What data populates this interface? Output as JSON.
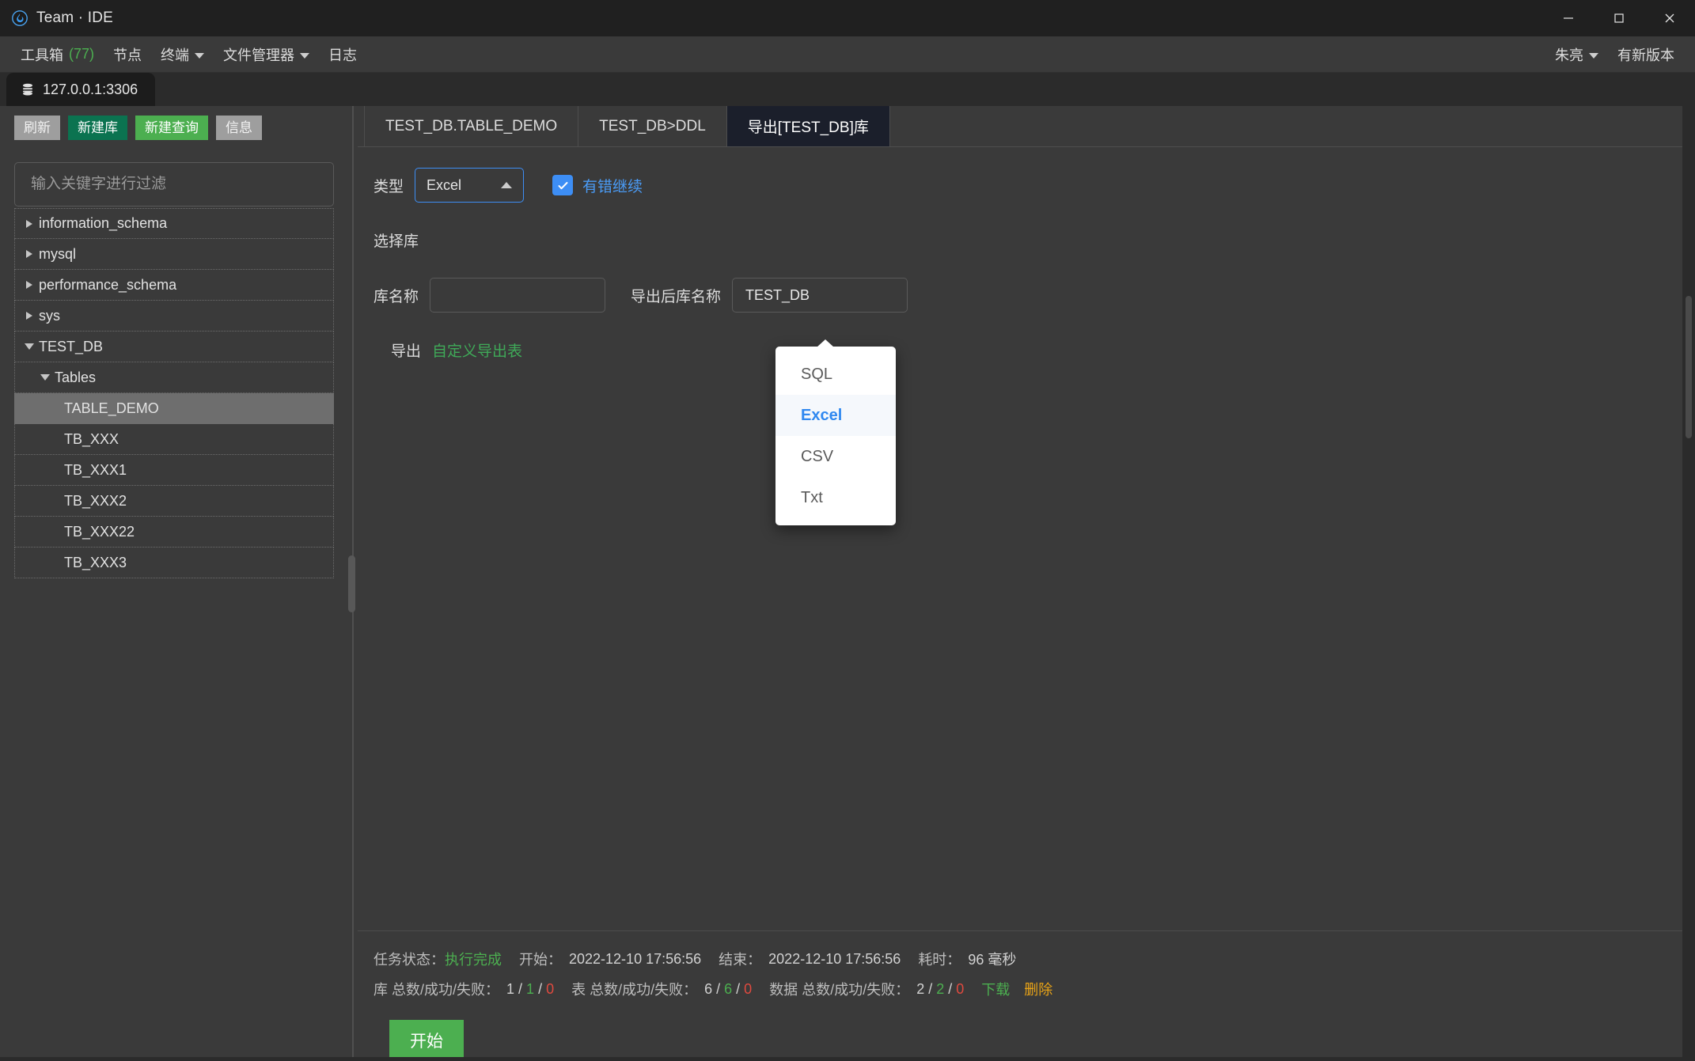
{
  "window": {
    "title": "Team · IDE",
    "logo_icon": "flame-icon",
    "minimize_icon": "minimize-icon",
    "maximize_icon": "maximize-icon",
    "close_icon": "close-icon"
  },
  "menubar": {
    "items": [
      {
        "label": "工具箱",
        "count": "(77)",
        "has_caret": false
      },
      {
        "label": "节点",
        "count": "",
        "has_caret": false
      },
      {
        "label": "终端",
        "count": "",
        "has_caret": true
      },
      {
        "label": "文件管理器",
        "count": "",
        "has_caret": true
      },
      {
        "label": "日志",
        "count": "",
        "has_caret": false
      }
    ],
    "user": "朱亮",
    "update": "有新版本"
  },
  "connection_tab": {
    "label": "127.0.0.1:3306",
    "icon": "database-icon"
  },
  "sidebar": {
    "buttons": [
      {
        "label": "刷新",
        "style": "gray"
      },
      {
        "label": "新建库",
        "style": "dkgreen"
      },
      {
        "label": "新建查询",
        "style": "green"
      },
      {
        "label": "信息",
        "style": "gray"
      }
    ],
    "filter_placeholder": "输入关键字进行过滤",
    "filter_value": "",
    "tree": [
      {
        "label": "information_schema",
        "level": 1,
        "state": "collapsed",
        "selected": false
      },
      {
        "label": "mysql",
        "level": 1,
        "state": "collapsed",
        "selected": false
      },
      {
        "label": "performance_schema",
        "level": 1,
        "state": "collapsed",
        "selected": false
      },
      {
        "label": "sys",
        "level": 1,
        "state": "collapsed",
        "selected": false
      },
      {
        "label": "TEST_DB",
        "level": 1,
        "state": "expanded",
        "selected": false
      },
      {
        "label": "Tables",
        "level": 2,
        "state": "expanded",
        "selected": false
      },
      {
        "label": "TABLE_DEMO",
        "level": 3,
        "state": "leaf",
        "selected": true
      },
      {
        "label": "TB_XXX",
        "level": 3,
        "state": "leaf",
        "selected": false
      },
      {
        "label": "TB_XXX1",
        "level": 3,
        "state": "leaf",
        "selected": false
      },
      {
        "label": "TB_XXX2",
        "level": 3,
        "state": "leaf",
        "selected": false
      },
      {
        "label": "TB_XXX22",
        "level": 3,
        "state": "leaf",
        "selected": false
      },
      {
        "label": "TB_XXX3",
        "level": 3,
        "state": "leaf",
        "selected": false
      }
    ]
  },
  "editor_tabs": [
    {
      "label": "TEST_DB.TABLE_DEMO",
      "active": false
    },
    {
      "label": "TEST_DB>DDL",
      "active": false
    },
    {
      "label": "导出[TEST_DB]库",
      "active": true
    }
  ],
  "export_form": {
    "type_label": "类型",
    "type_value": "Excel",
    "type_chevron_icon": "chevron-up-icon",
    "type_options": [
      {
        "label": "SQL",
        "selected": false
      },
      {
        "label": "Excel",
        "selected": true
      },
      {
        "label": "CSV",
        "selected": false
      },
      {
        "label": "Txt",
        "selected": false
      }
    ],
    "continue_on_error_label": "有错继续",
    "continue_on_error_checked": true,
    "check_icon": "check-icon",
    "select_db_label": "选择库",
    "db_name_label": "库名称",
    "db_name_value": "",
    "export_db_name_label": "导出后库名称",
    "export_db_name_value": "TEST_DB",
    "export_table_label": "导出",
    "custom_export_link": "自定义导出表"
  },
  "status": {
    "task_state_label": "任务状态：",
    "task_state_value": "执行完成",
    "start_label": "开始：",
    "start_value": "2022-12-10 17:56:56",
    "end_label": "结束：",
    "end_value": "2022-12-10 17:56:56",
    "elapsed_label": "耗时：",
    "elapsed_value": "96 毫秒",
    "db_counts_label": "库 总数/成功/失败：",
    "db_total": "1",
    "db_ok": "1",
    "db_fail": "0",
    "table_counts_label": "表 总数/成功/失败：",
    "table_total": "6",
    "table_ok": "6",
    "table_fail": "0",
    "data_counts_label": "数据 总数/成功/失败：",
    "data_total": "2",
    "data_ok": "2",
    "data_fail": "0",
    "download_link": "下载",
    "delete_link": "删除",
    "start_button": "开始"
  },
  "colors": {
    "accent_blue": "#3d8ef5",
    "success_green": "#4caf50",
    "dark_green": "#0b7350",
    "error_red": "#e04a3f",
    "warn_orange": "#e8a317",
    "panel_bg": "#3a3a3a",
    "titlebar_bg": "#202020",
    "active_tab_bg": "#1b1f2b"
  }
}
